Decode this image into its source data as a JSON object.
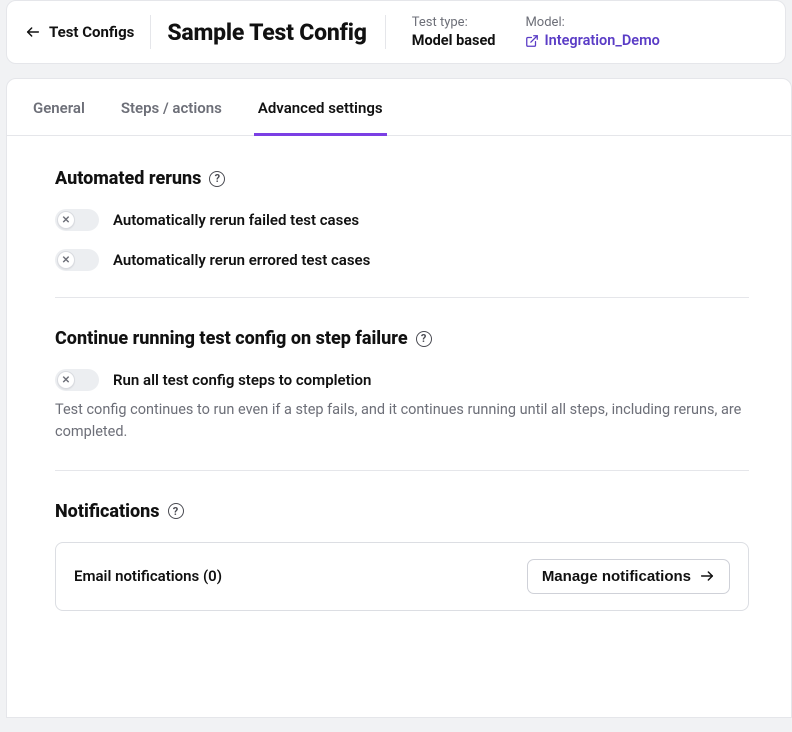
{
  "header": {
    "back_label": "Test Configs",
    "title": "Sample Test Config",
    "test_type_label": "Test type:",
    "test_type_value": "Model based",
    "model_label": "Model:",
    "model_value": "Integration_Demo"
  },
  "tabs": [
    {
      "label": "General"
    },
    {
      "label": "Steps / actions"
    },
    {
      "label": "Advanced settings"
    }
  ],
  "sections": {
    "reruns": {
      "title": "Automated reruns",
      "toggles": [
        {
          "label": "Automatically rerun failed test cases"
        },
        {
          "label": "Automatically rerun errored test cases"
        }
      ]
    },
    "continue": {
      "title": "Continue running test config on step failure",
      "toggle_label": "Run all test config steps to completion",
      "desc": "Test config continues to run even if a step fails, and it continues running until all steps, including reruns, are completed."
    },
    "notifications": {
      "title": "Notifications",
      "card_text": "Email notifications (0)",
      "manage_label": "Manage notifications"
    }
  }
}
